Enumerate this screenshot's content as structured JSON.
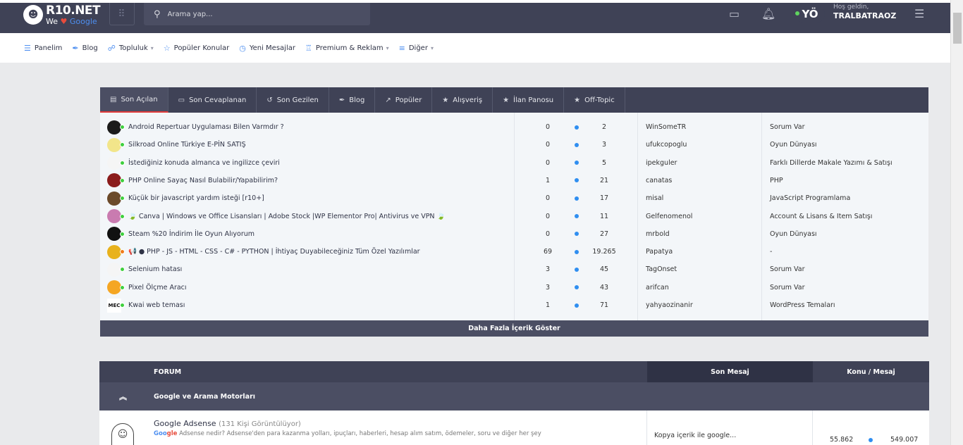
{
  "header": {
    "logo_main": "R10.NET",
    "logo_we": "We",
    "logo_heart": "♥",
    "logo_google": "Google",
    "search_placeholder": "Arama yap...",
    "avatar_text": "YÖ",
    "welcome_greeting": "Hoş geldin,",
    "username": "TRALBATRAOZ",
    "icons": [
      "grid-icon",
      "search-icon",
      "messages-icon",
      "bell-icon",
      "menu-settings-icon"
    ]
  },
  "nav": {
    "items": [
      {
        "label": "Panelim",
        "icon": "sliders-icon",
        "dropdown": false
      },
      {
        "label": "Blog",
        "icon": "feather-icon",
        "dropdown": false
      },
      {
        "label": "Topluluk",
        "icon": "users-icon",
        "dropdown": true
      },
      {
        "label": "Popüler Konular",
        "icon": "star-icon",
        "dropdown": false
      },
      {
        "label": "Yeni Mesajlar",
        "icon": "clock-icon",
        "dropdown": false
      },
      {
        "label": "Premium & Reklam",
        "icon": "trophy-icon",
        "dropdown": true
      },
      {
        "label": "Diğer",
        "icon": "list-icon",
        "dropdown": true
      }
    ]
  },
  "topics": {
    "tabs": [
      {
        "label": "Son Açılan",
        "icon": "document-icon",
        "active": true
      },
      {
        "label": "Son Cevaplanan",
        "icon": "comment-icon",
        "active": false
      },
      {
        "label": "Son Gezilen",
        "icon": "history-icon",
        "active": false
      },
      {
        "label": "Blog",
        "icon": "feather-icon",
        "active": false
      },
      {
        "label": "Popüler",
        "icon": "trend-icon",
        "active": false
      },
      {
        "label": "Alışveriş",
        "icon": "star-icon",
        "active": false
      },
      {
        "label": "İlan Panosu",
        "icon": "star-icon",
        "active": false
      },
      {
        "label": "Off-Topic",
        "icon": "star-icon",
        "active": false
      }
    ],
    "rows": [
      {
        "title": "Android Repertuar Uygulaması Bilen Varmdır ?",
        "replies": "0",
        "views": "2",
        "user": "WinSomeTR",
        "forum": "Sorum Var",
        "avatar_color": "#1b1b1b",
        "status_color": "#3ecf3e"
      },
      {
        "title": "Silkroad Online Türkiye E-PİN SATIŞ",
        "replies": "0",
        "views": "3",
        "user": "ufukcopoglu",
        "forum": "Oyun Dünyası",
        "avatar_color": "#f2e58a",
        "status_color": "#3ecf3e"
      },
      {
        "title": "İstediğiniz konuda almanca ve ingilizce çeviri",
        "replies": "0",
        "views": "5",
        "user": "ipekguler",
        "forum": "Farklı Dillerde Makale Yazımı & Satışı",
        "avatar_color": "#f5f5f5",
        "status_color": "#3ecf3e"
      },
      {
        "title": "PHP Online Sayaç Nasıl Bulabilir/Yapabilirim?",
        "replies": "1",
        "views": "21",
        "user": "canatas",
        "forum": "PHP",
        "avatar_color": "#8b1c1c",
        "status_color": "#3ecf3e"
      },
      {
        "title": "Küçük bir javascript yardım isteği [r10+]",
        "replies": "0",
        "views": "17",
        "user": "misal",
        "forum": "JavaScript Programlama",
        "avatar_color": "#6b4a2a",
        "status_color": "#3ecf3e"
      },
      {
        "title": "🍃 Canva | Windows ve Office Lisansları | Adobe Stock |WP Elementor Pro| Antivirus ve VPN 🍃",
        "replies": "0",
        "views": "11",
        "user": "Gelfenomenol",
        "forum": "Account & Lisans & Item Satışı",
        "avatar_color": "#c97bb0",
        "status_color": "#3ecf3e"
      },
      {
        "title": "Steam %20 İndirim İle Oyun Alıyorum",
        "replies": "0",
        "views": "27",
        "user": "mrbold",
        "forum": "Oyun Dünyası",
        "avatar_color": "#111111",
        "status_color": "#3ecf3e"
      },
      {
        "title": "📢 ● PHP - JS - HTML - CSS - C# - PYTHON | İhtiyaç Duyabileceğiniz Tüm Özel Yazılımlar",
        "replies": "69",
        "views": "19.265",
        "user": "Papatya",
        "forum": "-",
        "avatar_color": "#e8b21d",
        "status_color": "#f07a1a"
      },
      {
        "title": "Selenium hatası",
        "replies": "3",
        "views": "45",
        "user": "TagOnset",
        "forum": "Sorum Var",
        "avatar_color": "#f5f5f5",
        "status_color": "#3ecf3e"
      },
      {
        "title": "Pixel Ölçme Aracı",
        "replies": "3",
        "views": "43",
        "user": "arifcan",
        "forum": "Sorum Var",
        "avatar_color": "#f5a623",
        "status_color": "#3ecf3e"
      },
      {
        "title": "Kwai web teması",
        "replies": "1",
        "views": "71",
        "user": "yahyaozinanir",
        "forum": "WordPress Temaları",
        "avatar_color": "#ffffff",
        "status_color": "#3ecf3e",
        "avatar_text": "MEC"
      }
    ],
    "more_label": "Daha Fazla İçerik Göster"
  },
  "forum": {
    "head_forum": "FORUM",
    "head_last": "Son Mesaj",
    "head_counts": "Konu / Mesaj",
    "category": "Google ve Arama Motorları",
    "row": {
      "name": "Google Adsense",
      "views": "(131 Kişi Görüntülüyor)",
      "desc_g1": "Goo",
      "desc_g2": "gle",
      "desc_rest": " Adsense nedir? Adsense'den para kazanma yolları, ipuçları, haberleri, hesap alım satım, ödemeler, soru ve diğer her şey",
      "last_message": "Kopya içerik ile google...",
      "topics": "55.862",
      "messages": "549.007"
    }
  }
}
